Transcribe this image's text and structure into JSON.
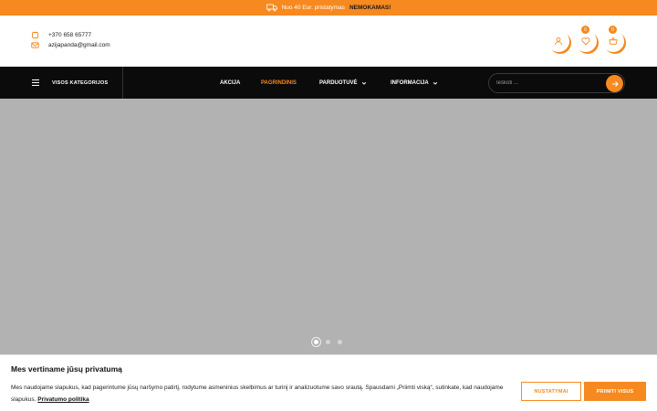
{
  "topbar": {
    "icon": "truck-icon",
    "text": "Nuo 40 Eur. pristatymas",
    "highlight": "NEMOKAMAS!"
  },
  "contact": {
    "phone": "+370 658 65777",
    "email": "azijapanda@gmail.com"
  },
  "header_icons": {
    "wishlist_count": "0",
    "cart_count": "0"
  },
  "nav": {
    "categories_label": "VISOS KATEGORIJOS",
    "items": [
      {
        "label": "AKCIJA"
      },
      {
        "label": "PAGRINDINIS"
      },
      {
        "label": "PARDUOTUVĖ"
      },
      {
        "label": "INFORMACIJA"
      }
    ],
    "search_placeholder": "Ieškoti ..."
  },
  "slider": {
    "slide_count": 3,
    "active_index": 0
  },
  "cookie": {
    "title": "Mes vertiname jūsų privatumą",
    "text": "Mes naudojame slapukus, kad pagerintume jūsų naršymo patirtį, rodytume asmeninius skelbimus ar turinį ir analizuotume savo srautą. Spausdami „Priimti viską“, sutinkate, kad naudojame slapukus.",
    "link": "Privatumo politika",
    "settings_button": "NUSTATYMAI",
    "accept_button": "PRIIMTI VISUS"
  },
  "colors": {
    "accent": "#f6891f",
    "nav_bg": "#0b0b0b",
    "hero_bg": "#b2b2b2"
  }
}
